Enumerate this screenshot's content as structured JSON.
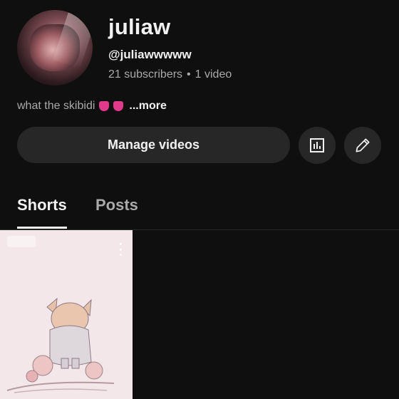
{
  "channel": {
    "name": "juliaw",
    "handle": "@juliawwwww",
    "subscribers": "21 subscribers",
    "separator": "•",
    "videos": "1 video",
    "description": "what the skibidi",
    "more": "...more"
  },
  "actions": {
    "manage_label": "Manage videos",
    "analytics_icon": "analytics-icon",
    "edit_icon": "pencil-icon"
  },
  "tabs": [
    {
      "label": "Shorts",
      "active": true
    },
    {
      "label": "Posts",
      "active": false
    }
  ],
  "colors": {
    "background": "#0f0f0f",
    "button": "#272727",
    "text": "#f1f1f1",
    "secondary_text": "#aaaaaa",
    "emoji": "#e03a8a",
    "thumbnail_bg": "#f3e7e9"
  }
}
